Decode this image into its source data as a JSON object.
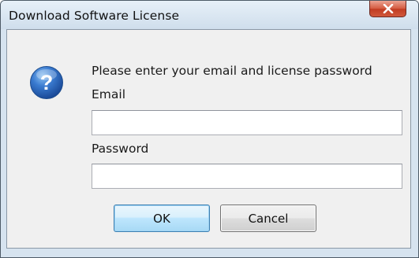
{
  "window": {
    "title": "Download Software License",
    "close_icon": "close-icon",
    "close_color": "#c9462c"
  },
  "dialog": {
    "icon": "question-icon",
    "icon_color": "#2c64b8",
    "prompt": "Please enter your email and license password",
    "email_label": "Email",
    "email_value": "",
    "password_label": "Password",
    "password_value": ""
  },
  "buttons": {
    "ok_label": "OK",
    "cancel_label": "Cancel"
  }
}
